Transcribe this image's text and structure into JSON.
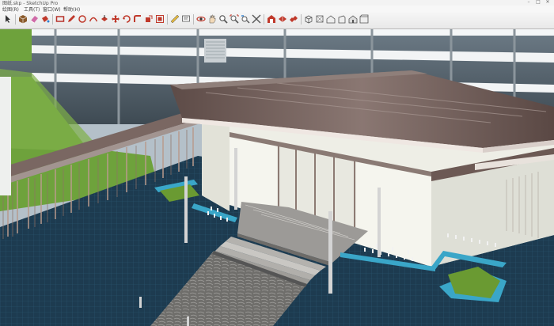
{
  "window": {
    "title": "图纸.skp - SketchUp Pro",
    "controls": {
      "minimize": "–",
      "maximize": "□",
      "close": "✕"
    }
  },
  "menu": {
    "items": [
      {
        "label": "绘图(R)"
      },
      {
        "label": "工具(T)"
      },
      {
        "label": "窗口(W)"
      },
      {
        "label": "帮助(H)"
      }
    ]
  },
  "toolbar": {
    "buttons": [
      {
        "name": "select-tool",
        "icon": "arrow-icon",
        "color": "#333333"
      },
      {
        "name": "make-component-tool",
        "icon": "cube-icon",
        "color": "#8a5a2b"
      },
      {
        "name": "eraser-tool",
        "icon": "eraser-icon",
        "color": "#d06aa8"
      },
      {
        "name": "paint-bucket-tool",
        "icon": "bucket-icon",
        "color": "#c0392b"
      },
      {
        "name": "rectangle-tool",
        "icon": "rectangle-icon",
        "color": "#b8322a"
      },
      {
        "name": "line-tool",
        "icon": "pencil-icon",
        "color": "#c0392b"
      },
      {
        "name": "circle-tool",
        "icon": "circle-icon",
        "color": "#c0392b"
      },
      {
        "name": "arc-tool",
        "icon": "arc-icon",
        "color": "#c0392b"
      },
      {
        "name": "push-pull-tool",
        "icon": "pushpull-icon",
        "color": "#c0392b"
      },
      {
        "name": "move-tool",
        "icon": "move-icon",
        "color": "#c0392b"
      },
      {
        "name": "rotate-tool",
        "icon": "rotate-icon",
        "color": "#c0392b"
      },
      {
        "name": "follow-me-tool",
        "icon": "followme-icon",
        "color": "#c0392b"
      },
      {
        "name": "scale-tool",
        "icon": "scale-icon",
        "color": "#c0392b"
      },
      {
        "name": "offset-tool",
        "icon": "offset-icon",
        "color": "#c0392b"
      },
      {
        "name": "tape-measure-tool",
        "icon": "tape-icon",
        "color": "#555555"
      },
      {
        "name": "text-tool",
        "icon": "text-icon",
        "color": "#555555"
      },
      {
        "name": "orbit-tool",
        "icon": "orbit-icon",
        "color": "#c0392b"
      },
      {
        "name": "pan-tool",
        "icon": "hand-icon",
        "color": "#555555"
      },
      {
        "name": "zoom-tool",
        "icon": "magnifier-icon",
        "color": "#555555"
      },
      {
        "name": "zoom-extents-tool",
        "icon": "zoom-extents-icon",
        "color": "#555555"
      },
      {
        "name": "previous-view-tool",
        "icon": "previous-icon",
        "color": "#555555"
      },
      {
        "name": "next-view-tool",
        "icon": "next-icon",
        "color": "#555555"
      },
      {
        "name": "get-models-tool",
        "icon": "warehouse-icon",
        "color": "#c0392b"
      },
      {
        "name": "share-model-tool",
        "icon": "share-icon",
        "color": "#c0392b"
      },
      {
        "name": "components-tool",
        "icon": "components-icon",
        "color": "#c0392b"
      },
      {
        "name": "iso-view",
        "icon": "iso-icon",
        "color": "#555555"
      },
      {
        "name": "top-view",
        "icon": "top-view-icon",
        "color": "#555555"
      },
      {
        "name": "front-view",
        "icon": "front-view-icon",
        "color": "#555555"
      },
      {
        "name": "right-view",
        "icon": "right-view-icon",
        "color": "#555555"
      },
      {
        "name": "back-view",
        "icon": "back-view-icon",
        "color": "#555555"
      },
      {
        "name": "left-view",
        "icon": "left-view-icon",
        "color": "#555555"
      }
    ]
  },
  "viewport": {
    "name": "3d-model-viewport",
    "colors": {
      "sky": "#b4c0c9",
      "water": "#1e3d52",
      "water_highlight": "#3aa6c8",
      "grass": "#6ea23c",
      "wall": "#eeeee6",
      "roof": "#6d5a55",
      "glass": "#4e5a63",
      "paving": "#7a7a78"
    }
  }
}
